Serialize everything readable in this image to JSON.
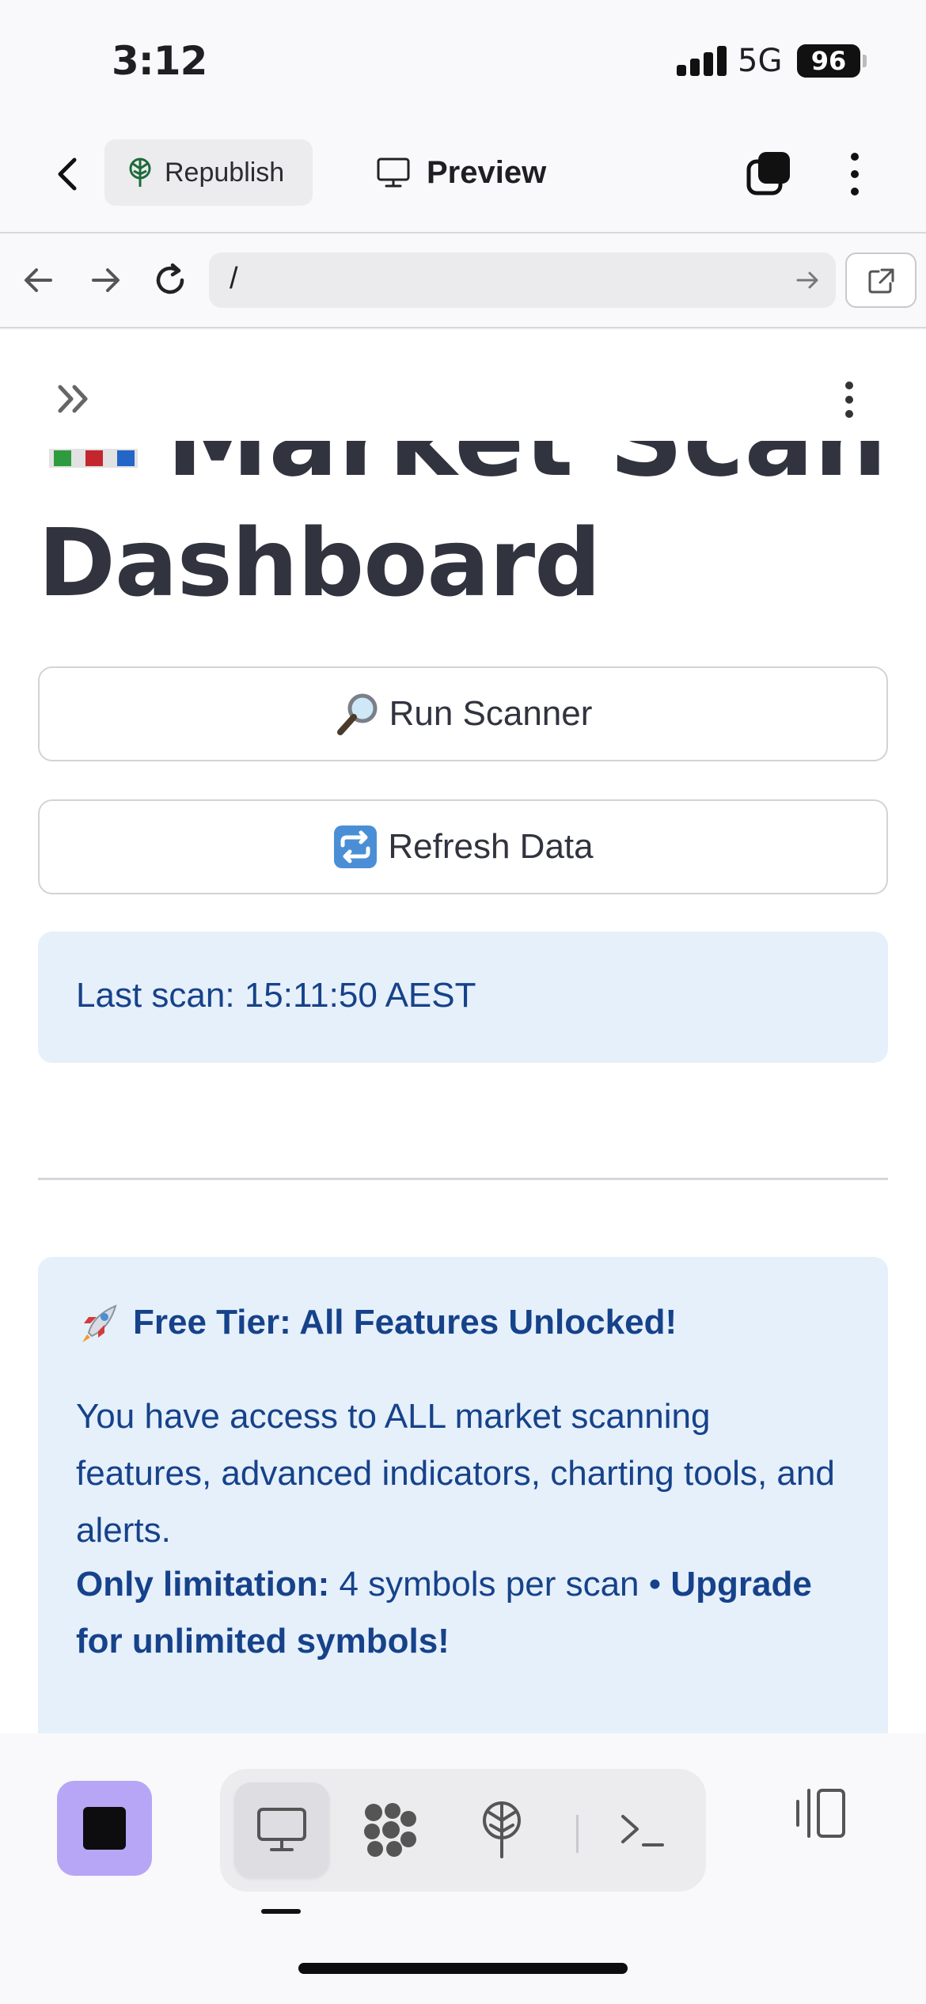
{
  "status_bar": {
    "time": "3:12",
    "network": "5G",
    "battery": "96"
  },
  "toolbar": {
    "republish_label": "Republish",
    "preview_label": "Preview"
  },
  "url_bar": {
    "url": "/"
  },
  "app": {
    "title_line1": "Market Scanner",
    "title_line2": "Dashboard",
    "run_scanner_label": "Run Scanner",
    "refresh_label": "Refresh Data",
    "last_scan": "Last scan: 15:11:50 AEST",
    "promo": {
      "heading": "Free Tier: All Features Unlocked!",
      "body": "You have access to ALL market scanning features, advanced indicators, charting tools, and alerts.",
      "limit_prefix": "Only limitation:",
      "limit_text": " 4 symbols per scan • ",
      "upgrade_text": "Upgrade for unlimited symbols!"
    }
  },
  "icons": {
    "run_scanner": "magnifying-glass-icon",
    "refresh": "repeat-icon",
    "promo": "rocket-icon"
  },
  "colors": {
    "accent_purple": "#b7a6f6",
    "info_bg": "#e6f0fb",
    "info_text": "#16428a",
    "title_text": "#31333f"
  }
}
